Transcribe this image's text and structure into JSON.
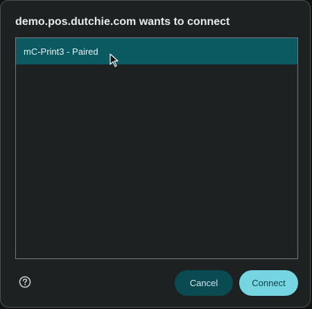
{
  "dialog": {
    "title": "demo.pos.dutchie.com wants to connect",
    "devices": [
      {
        "label": "mC-Print3 - Paired",
        "selected": true
      }
    ],
    "help_icon": "help-circle-icon",
    "cancel_label": "Cancel",
    "connect_label": "Connect"
  },
  "colors": {
    "selected_row": "#0b5a62",
    "connect_button": "#75d6e2",
    "cancel_button": "#0a4b52",
    "dialog_background": "#1d2122"
  }
}
